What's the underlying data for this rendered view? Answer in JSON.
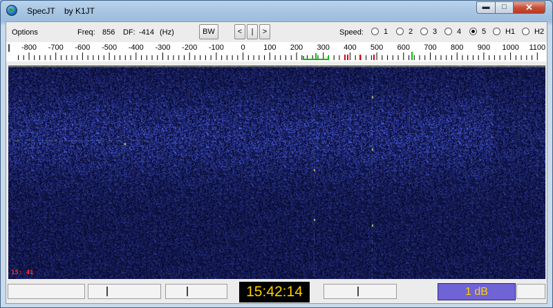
{
  "window": {
    "title": "SpecJT",
    "author": "by K1JT"
  },
  "toolbar": {
    "options_label": "Options",
    "freq_label": "Freq:",
    "freq_value": "856",
    "df_label": "DF:",
    "df_value": "-414",
    "df_unit": "(Hz)",
    "bw_label": "BW",
    "prev_label": "<",
    "center_label": "|",
    "next_label": ">",
    "speed_label": "Speed:",
    "speeds": [
      {
        "label": "1",
        "selected": false
      },
      {
        "label": "2",
        "selected": false
      },
      {
        "label": "3",
        "selected": false
      },
      {
        "label": "4",
        "selected": false
      },
      {
        "label": "5",
        "selected": true
      },
      {
        "label": "H1",
        "selected": false
      },
      {
        "label": "H2",
        "selected": false
      }
    ]
  },
  "scale": {
    "ticks": [
      "-800",
      "-700",
      "-600",
      "-500",
      "-400",
      "-300",
      "-200",
      "-100",
      "0",
      "100",
      "200",
      "300",
      "400",
      "500",
      "600",
      "700",
      "800",
      "900",
      "1000",
      "1100"
    ],
    "marker_colors": {
      "green": "#00c000",
      "red": "#e00000"
    }
  },
  "waterfall": {
    "timestamp": "15: 41",
    "background": "#06082a"
  },
  "status": {
    "clock": "15:42:14",
    "gain": "1 dB"
  }
}
